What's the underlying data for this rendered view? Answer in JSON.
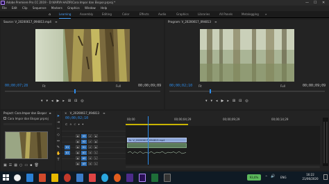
{
  "window": {
    "title": "Adobe Premiere Pro CC 2019 - D:\\KARYA HAZIR\\Cara Impor dan Ekspor.prproj *",
    "controls": [
      "—",
      "☐",
      "✕"
    ]
  },
  "menu": [
    "File",
    "Edit",
    "Clip",
    "Sequence",
    "Markers",
    "Graphics",
    "Window",
    "Help"
  ],
  "workspaces": {
    "home": "⌂",
    "tabs": [
      "Learning",
      "Assembly",
      "Editing",
      "Color",
      "Effects",
      "Audio",
      "Graphics",
      "Libraries",
      "All Panels",
      "Metalogging"
    ],
    "active": "Learning",
    "more": "»"
  },
  "source_monitor": {
    "tab_label": "Source: V_20200617_094813.mp4",
    "tab_menu": "≡",
    "timecode": "00;00;07;28",
    "fit": "Fit",
    "quality": "Full",
    "duration": "00;00;09;09"
  },
  "program_monitor": {
    "tab_label": "Program: V_20200617_094813",
    "tab_menu": "≡",
    "timecode": "00;00;02;10",
    "fit": "Fit",
    "quality": "Full",
    "duration": "00;00;09;09"
  },
  "project_panel": {
    "tab_label": "Project: Cara Impor dan Ekspor",
    "tab_menu": "≡",
    "more": "»",
    "file_name": "Cara Impor dan Ekspor.prproj"
  },
  "timeline": {
    "close": "×",
    "tab_label": "V_20200617_094813",
    "tab_menu": "≡",
    "timecode": "00;00;02;10",
    "ruler_ticks": [
      "00;00",
      "00;00;04;29",
      "00;00;09;29",
      "00;00;14;29"
    ],
    "tracks": [
      {
        "name": "V3",
        "type": "video"
      },
      {
        "name": "V2",
        "type": "video"
      },
      {
        "name": "V1",
        "type": "video"
      },
      {
        "name": "A1",
        "type": "audio"
      },
      {
        "name": "A2",
        "type": "audio"
      },
      {
        "name": "A3",
        "type": "audio"
      }
    ],
    "source_patch_v": "V1",
    "source_patch_a": "A1",
    "toggle_labels": {
      "lock": "🔒",
      "sync": "⇄",
      "eye": "◉",
      "mute": "M",
      "solo": "S",
      "voice": "🎤"
    },
    "clip_video_label": "V_20200617_094813.mp4",
    "clip_fx_label": "fx",
    "playhead_fraction": 0.115
  },
  "taskbar": {
    "battery": "93,6%",
    "time": "16:22",
    "date": "21/06/2020",
    "tray": [
      "^",
      "🔊",
      "ENG"
    ]
  },
  "colors": {
    "accent": "#2d8ceb",
    "clip_video": "#8aa4d6",
    "clip_audio": "#5a7a5a",
    "taskbar": "#0f1a24"
  }
}
